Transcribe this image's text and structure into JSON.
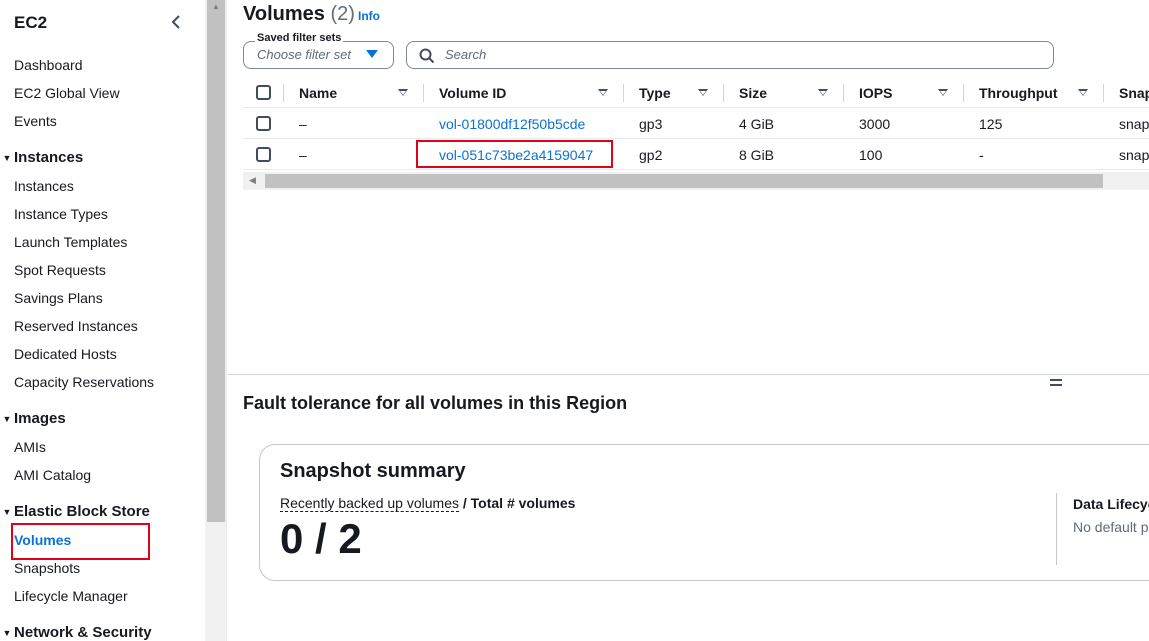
{
  "sidebar": {
    "title": "EC2",
    "top_links": [
      "Dashboard",
      "EC2 Global View",
      "Events"
    ],
    "sections": [
      {
        "label": "Instances",
        "items": [
          "Instances",
          "Instance Types",
          "Launch Templates",
          "Spot Requests",
          "Savings Plans",
          "Reserved Instances",
          "Dedicated Hosts",
          "Capacity Reservations"
        ]
      },
      {
        "label": "Images",
        "items": [
          "AMIs",
          "AMI Catalog"
        ]
      },
      {
        "label": "Elastic Block Store",
        "items": [
          "Volumes",
          "Snapshots",
          "Lifecycle Manager"
        ]
      },
      {
        "label": "Network & Security",
        "items": []
      }
    ],
    "active_item": "Volumes"
  },
  "header": {
    "title": "Volumes",
    "count": "(2)",
    "info": "Info"
  },
  "filters": {
    "saved_label": "Saved filter sets",
    "saved_placeholder": "Choose filter set",
    "search_placeholder": "Search"
  },
  "table": {
    "columns": [
      "Name",
      "Volume ID",
      "Type",
      "Size",
      "IOPS",
      "Throughput",
      "Snap"
    ],
    "rows": [
      {
        "name": "–",
        "volume_id": "vol-01800df12f50b5cde",
        "type": "gp3",
        "size": "4 GiB",
        "iops": "3000",
        "throughput": "125",
        "snapshot": "snap"
      },
      {
        "name": "–",
        "volume_id": "vol-051c73be2a4159047",
        "type": "gp2",
        "size": "8 GiB",
        "iops": "100",
        "throughput": "-",
        "snapshot": "snap"
      }
    ]
  },
  "fault_tolerance": {
    "title": "Fault tolerance for all volumes in this Region",
    "card_title": "Snapshot summary",
    "sub_link": "Recently backed up volumes",
    "sub_rest": " / Total # volumes",
    "big_value": "0 / 2",
    "right_title": "Data Lifecyc",
    "right_text": "No default p"
  },
  "colors": {
    "link": "#0972d3",
    "highlight": "#e3001b"
  }
}
